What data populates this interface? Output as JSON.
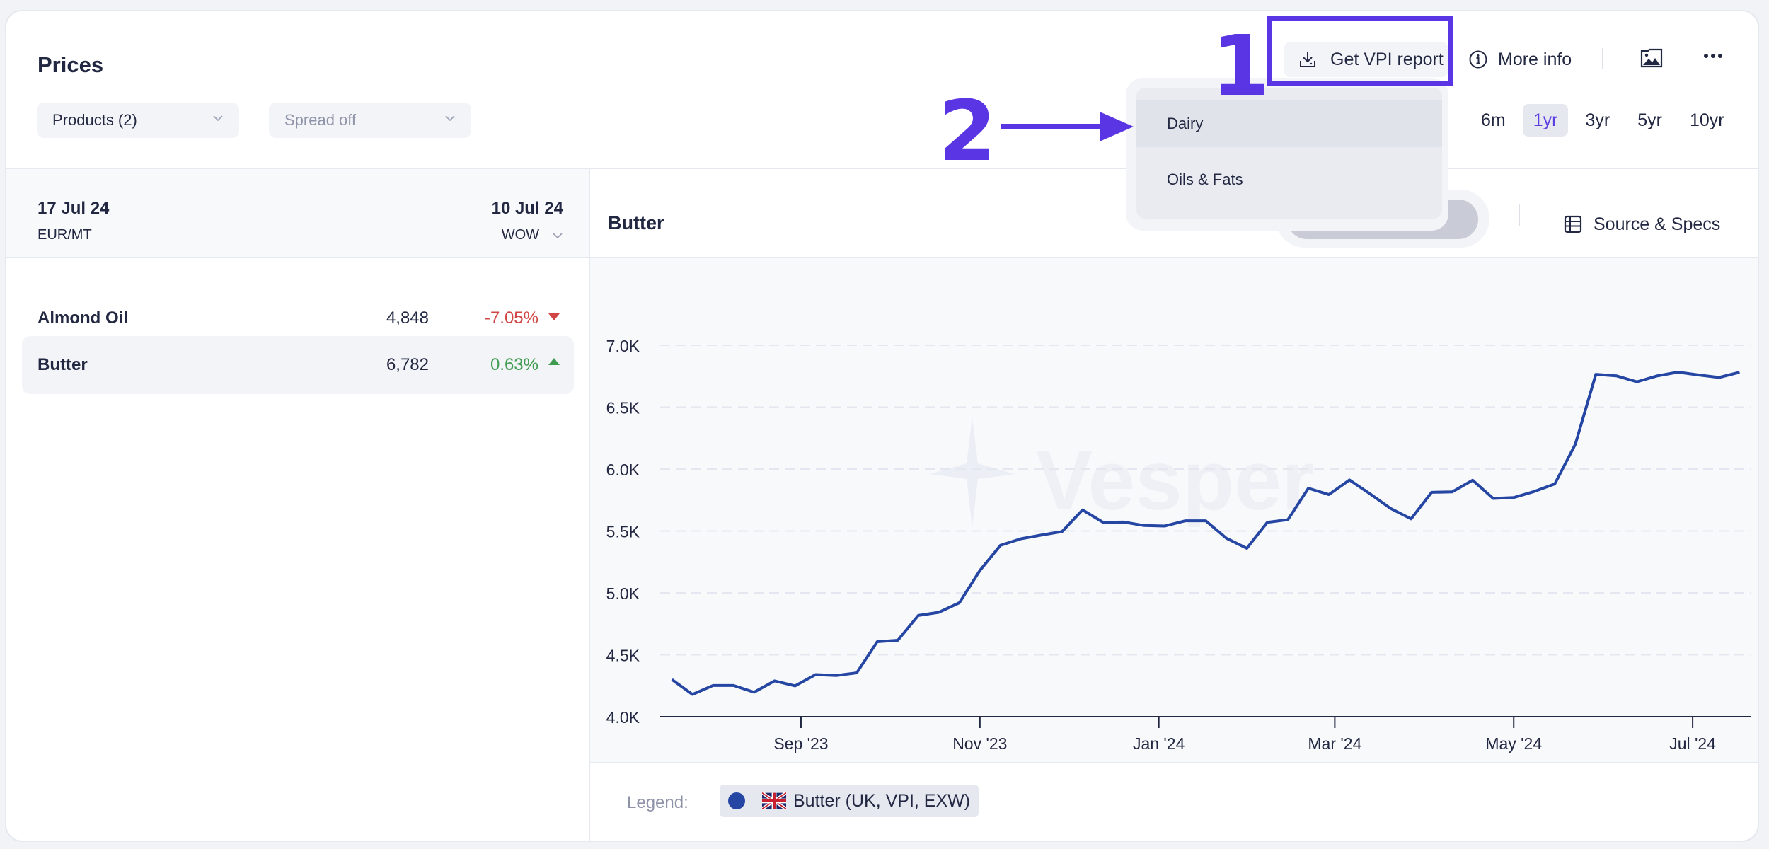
{
  "header": {
    "title": "Prices",
    "products_dropdown": "Products (2)",
    "spread_dropdown": "Spread off",
    "get_report_label": "Get VPI report",
    "more_info_label": "More info",
    "icons": {
      "download": "download-icon",
      "info": "info-icon",
      "image": "image-icon",
      "more": "more-icon"
    },
    "range_tabs": [
      {
        "label": "6m",
        "active": false
      },
      {
        "label": "1yr",
        "active": true
      },
      {
        "label": "3yr",
        "active": false
      },
      {
        "label": "5yr",
        "active": false
      },
      {
        "label": "10yr",
        "active": false
      }
    ]
  },
  "report_menu": {
    "items": [
      {
        "label": "Dairy",
        "hovered": true
      },
      {
        "label": "Oils & Fats",
        "hovered": false
      }
    ]
  },
  "annotations": {
    "step1": "1",
    "step2": "2",
    "color": "#5a35e4"
  },
  "left_panel": {
    "current_date": "17 Jul 24",
    "unit": "EUR/MT",
    "compare_date": "10 Jul 24",
    "compare_mode": "WOW",
    "rows": [
      {
        "name": "Almond Oil",
        "value": "4,848",
        "change": "-7.05%",
        "direction": "down",
        "selected": false
      },
      {
        "name": "Butter",
        "value": "6,782",
        "change": "0.63%",
        "direction": "up",
        "selected": true
      }
    ]
  },
  "chart_header": {
    "title": "Butter",
    "source_label": "Source & Specs"
  },
  "legend": {
    "label": "Legend:",
    "entry": "Butter (UK, VPI, EXW)",
    "color": "#2646a3",
    "flag": "uk-flag"
  },
  "watermark": "Vesper",
  "colors": {
    "accent": "#5b3fe0",
    "line": "#2646a3",
    "negative": "#d14545",
    "positive": "#3f9b50"
  },
  "chart_data": {
    "type": "line",
    "title": "Butter",
    "xlabel": "",
    "ylabel": "",
    "x_start": "2023-07-19",
    "x_step_days": 7,
    "xlim": [
      "2023-07-15",
      "2024-07-21"
    ],
    "ylim": [
      4000,
      7000
    ],
    "yticks": [
      4000,
      4500,
      5000,
      5500,
      6000,
      6500,
      7000
    ],
    "ytick_labels": [
      "4.0K",
      "4.5K",
      "5.0K",
      "5.5K",
      "6.0K",
      "6.5K",
      "7.0K"
    ],
    "xticks": [
      {
        "date": "2023-09-01",
        "label": "Sep '23"
      },
      {
        "date": "2023-11-01",
        "label": "Nov '23"
      },
      {
        "date": "2024-01-01",
        "label": "Jan '24"
      },
      {
        "date": "2024-03-01",
        "label": "Mar '24"
      },
      {
        "date": "2024-05-01",
        "label": "May '24"
      },
      {
        "date": "2024-07-01",
        "label": "Jul '24"
      }
    ],
    "grid": true,
    "legend": "bottom",
    "series": [
      {
        "name": "Butter (UK, VPI, EXW)",
        "values": [
          4300,
          4180,
          4252,
          4252,
          4198,
          4289,
          4249,
          4340,
          4333,
          4354,
          4606,
          4617,
          4818,
          4843,
          4920,
          5181,
          5384,
          5437,
          5467,
          5495,
          5670,
          5570,
          5572,
          5544,
          5540,
          5582,
          5582,
          5442,
          5360,
          5570,
          5591,
          5845,
          5794,
          5912,
          5800,
          5682,
          5598,
          5812,
          5816,
          5910,
          5763,
          5770,
          5819,
          5880,
          6200,
          6765,
          6753,
          6705,
          6753,
          6783,
          6760,
          6740,
          6782
        ]
      }
    ]
  }
}
